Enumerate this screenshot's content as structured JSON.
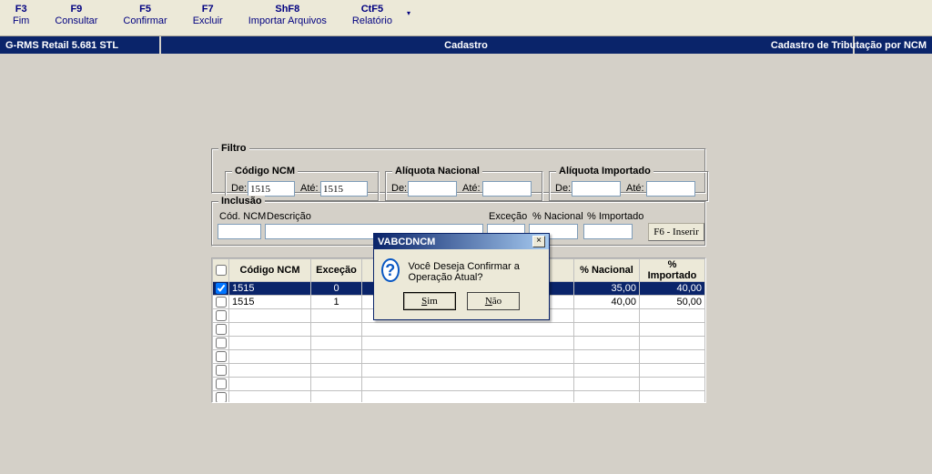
{
  "toolbar": {
    "items": [
      {
        "key": "F3",
        "label": "Fim"
      },
      {
        "key": "F9",
        "label": "Consultar"
      },
      {
        "key": "F5",
        "label": "Confirmar"
      },
      {
        "key": "F7",
        "label": "Excluir"
      },
      {
        "key": "ShF8",
        "label": "Importar Arquivos"
      },
      {
        "key": "CtF5",
        "label": "Relatório"
      }
    ]
  },
  "titlebar": {
    "left": "G-RMS Retail 5.681 STL",
    "center": "Cadastro",
    "right": "Cadastro de Tributação por NCM"
  },
  "filtro": {
    "legend": "Filtro",
    "codncm": {
      "legend": "Código NCM",
      "de_label": "De:",
      "de_value": "1515",
      "ate_label": "Até:",
      "ate_value": "1515"
    },
    "aliqn": {
      "legend": "Alíquota Nacional",
      "de_label": "De:",
      "de_value": "",
      "ate_label": "Até:",
      "ate_value": ""
    },
    "aliqi": {
      "legend": "Alíquota Importado",
      "de_label": "De:",
      "de_value": "",
      "ate_label": "Até:",
      "ate_value": ""
    }
  },
  "inclusao": {
    "legend": "Inclusão",
    "codncm_label": "Cód. NCM",
    "descricao_label": "Descrição",
    "excecao_label": "Exceção",
    "nacional_label": "% Nacional",
    "importado_label": "% Importado",
    "inserir_label": "F6 - Inserir"
  },
  "grid": {
    "headers": {
      "cb": "",
      "codncm": "Código NCM",
      "excecao": "Exceção",
      "descricao": "",
      "nacional": "% Nacional",
      "importado": "% Importado"
    },
    "rows": [
      {
        "checked": true,
        "codncm": "1515",
        "excecao": "0",
        "descricao": "",
        "nacional": "35,00",
        "importado": "40,00",
        "selected": true
      },
      {
        "checked": false,
        "codncm": "1515",
        "excecao": "1",
        "descricao": "",
        "nacional": "40,00",
        "importado": "50,00",
        "selected": false
      }
    ],
    "empty_rows": 8
  },
  "dialog": {
    "title": "VABCDNCM",
    "message": "Você Deseja Confirmar a Operação Atual?",
    "yes": "Sim",
    "no": "Não",
    "icon": "?"
  }
}
